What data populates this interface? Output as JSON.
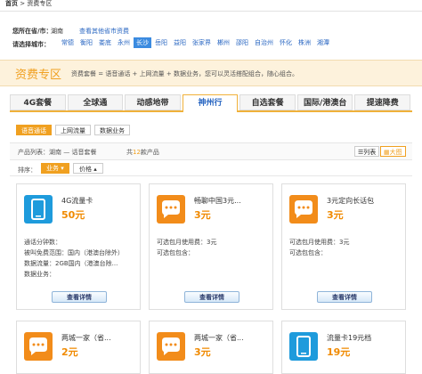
{
  "breadcrumb": {
    "home": "首页",
    "sep": " > ",
    "current": "资费专区"
  },
  "province": {
    "label": "您所在省/市：",
    "value": "湖南",
    "link": "查看其他省市资费"
  },
  "city": {
    "label": "请选择城市：",
    "items": [
      "常德",
      "衡阳",
      "娄底",
      "永州",
      "长沙",
      "岳阳",
      "益阳",
      "张家界",
      "郴州",
      "邵阳",
      "自治州",
      "怀化",
      "株洲",
      "湘潭"
    ],
    "selected": "长沙"
  },
  "zone": {
    "title": "资费专区",
    "desc": "资费套餐 = 语音通话 + 上网流量 + 数据业务，您可以灵活搭配组合，随心组合。"
  },
  "tabs": [
    "4G套餐",
    "全球通",
    "动感地带",
    "神州行",
    "自选套餐",
    "国际/港澳台",
    "提速降费"
  ],
  "tabs_selected": "神州行",
  "subtabs": [
    "语音通话",
    "上网流量",
    "数据业务"
  ],
  "subtabs_selected": "语音通话",
  "list": {
    "text": "产品列表：湖南 — 话音套餐",
    "count_prefix": "共",
    "count": "12",
    "count_suffix": "款产品",
    "view_list": "列表",
    "view_big": "大图"
  },
  "sort": {
    "label": "排序：",
    "business": "业务",
    "price": "价格"
  },
  "cards": [
    {
      "name": "4G流量卡",
      "price": "50元",
      "icon": "phone-icon",
      "lines": [
        "通话分钟数：",
        "被叫免费范围：国内（港澳台除外）",
        "数据流量：2GB国内（港澳台除...",
        "数据业务："
      ],
      "button": "查看详情"
    },
    {
      "name": "畅聊中国3元...",
      "price": "3元",
      "icon": "chat-icon",
      "lines": [
        "可选包月使用费：3元",
        "可选包包含："
      ],
      "button": "查看详情"
    },
    {
      "name": "3元定向长话包",
      "price": "3元",
      "icon": "chat-icon",
      "lines": [
        "可选包月使用费：3元",
        "可选包包含："
      ],
      "button": "查看详情"
    },
    {
      "name": "两城一家（省...",
      "price": "2元",
      "icon": "chat-icon"
    },
    {
      "name": "两城一家（省...",
      "price": "3元",
      "icon": "chat-icon"
    },
    {
      "name": "流量卡19元档",
      "price": "19元",
      "icon": "phone-icon"
    }
  ],
  "colors": {
    "accent": "#f0a020",
    "link": "#2a67c2",
    "icon_blue": "#1e9bdc",
    "icon_orange": "#f28c1a"
  }
}
